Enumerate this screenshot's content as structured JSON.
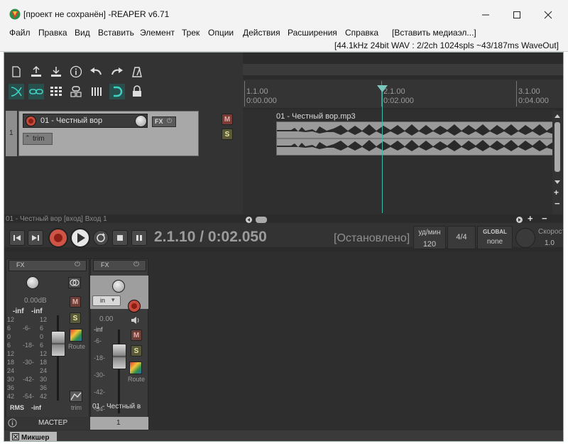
{
  "window": {
    "title": "[проект не сохранён] -REAPER v6.71"
  },
  "menu": [
    "Файл",
    "Правка",
    "Вид",
    "Вставить",
    "Элемент",
    "Трек",
    "Опции",
    "Действия",
    "Расширения",
    "Справка",
    "[Вставить медиаэл...]"
  ],
  "info": "[44.1kHz 24bit WAV : 2/2ch 1024spls ~43/187ms WaveOut]",
  "ruler": {
    "markers": [
      {
        "bar": "1.1.00",
        "time": "0:00.000"
      },
      {
        "bar": "2.1.00",
        "time": "0:02.000"
      },
      {
        "bar": "3.1.00",
        "time": "0:04.000"
      }
    ]
  },
  "track": {
    "number": "1",
    "name": "01 - Честный вор",
    "fx": "FX",
    "trim": "trim",
    "mute": "M",
    "solo": "S",
    "input_label": "01 - Честный вор [вход] Вход 1"
  },
  "item": {
    "name": "01 - Честный вор.mp3"
  },
  "transport": {
    "timecode": "2.1.10 / 0:02.050",
    "status": "[Остановлено]",
    "bpm_label": "уд/мин",
    "bpm": "120",
    "signature": "4/4",
    "global_label": "GLOBAL",
    "global_value": "none",
    "rate_label": "Скорость",
    "rate_value": "1.0"
  },
  "mixer": {
    "master": {
      "fx": "FX",
      "volume": "0.00dB",
      "peak_l": "-inf",
      "peak_r": "-inf",
      "scale_left": [
        "12",
        "6",
        "0",
        "6",
        "12",
        "18",
        "24",
        "30",
        "36",
        "42"
      ],
      "scale_mid": [
        "-6-",
        "-18-",
        "-30-",
        "-42-",
        "-54-"
      ],
      "scale_right": [
        "12",
        "6",
        "0",
        "6",
        "12",
        "18",
        "24",
        "30",
        "36",
        "42"
      ],
      "rms_label": "RMS",
      "rms_value": "-inf",
      "mute": "M",
      "solo": "S",
      "route": "Route",
      "trim": "trim",
      "name": "МАСТЕР"
    },
    "track1": {
      "fx": "FX",
      "input": "in",
      "volume": "0.00",
      "peak": "-inf",
      "scale": [
        "-6-",
        "-18-",
        "-30-",
        "-42-",
        "-54-"
      ],
      "scale_inner": [
        "-6-",
        "-18-",
        "-30-",
        "-42-",
        "-54-"
      ],
      "mute": "M",
      "solo": "S",
      "route": "Route",
      "name": "01 - Честный в",
      "number": "1"
    },
    "tab": "Микшер"
  }
}
